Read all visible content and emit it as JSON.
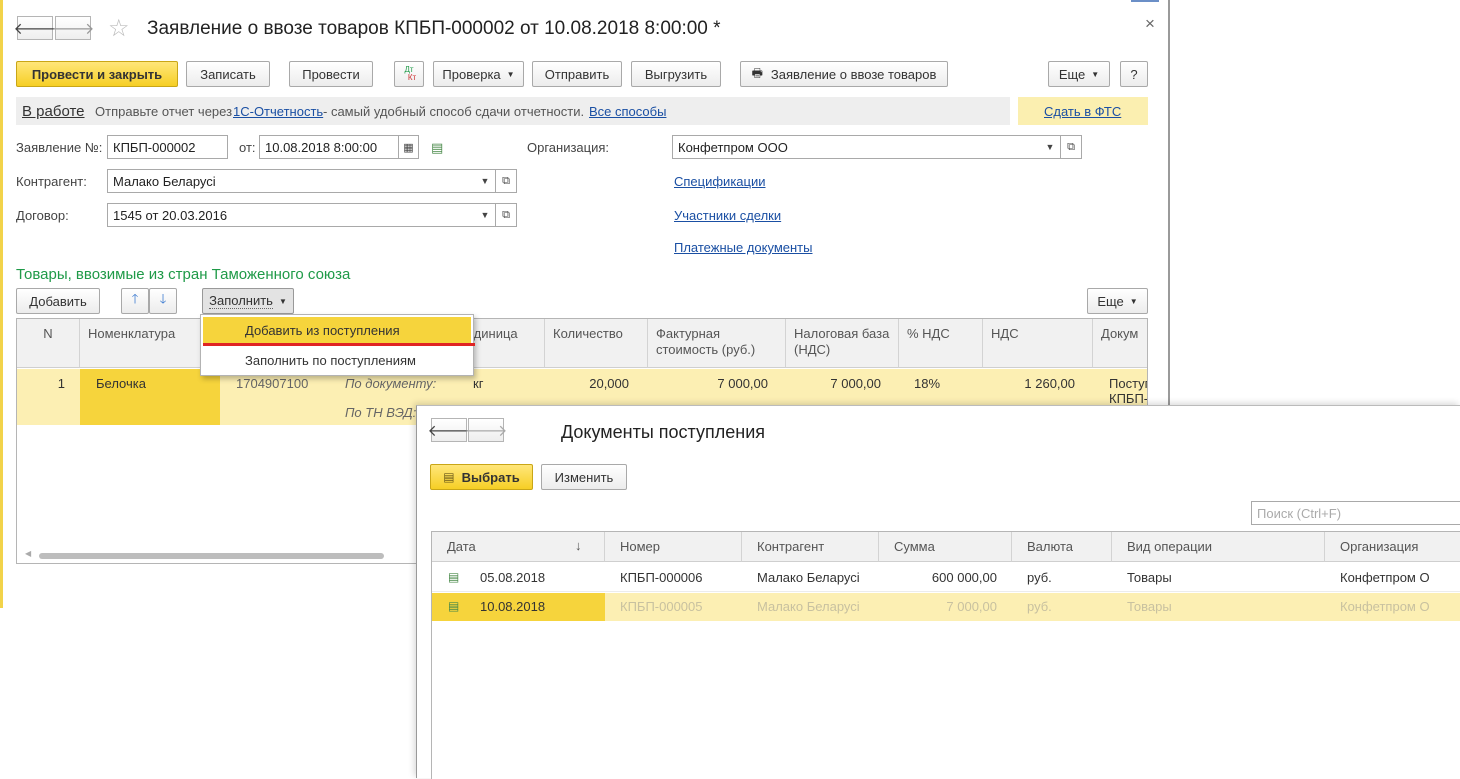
{
  "main": {
    "title": "Заявление о ввозе товаров КПБП-000002 от 10.08.2018 8:00:00 *",
    "close": "×",
    "toolbar": {
      "post_close": "Провести и закрыть",
      "save": "Записать",
      "post": "Провести",
      "dtkt_top": "Дт",
      "dtkt_bottom": "Кт",
      "check": "Проверка",
      "send": "Отправить",
      "upload": "Выгрузить",
      "print_form": "Заявление о ввозе товаров",
      "more": "Еще",
      "help": "?"
    },
    "info_bar": {
      "status_link": "В работе",
      "text_before": "Отправьте отчет через",
      "service_link": "1С-Отчетность",
      "text_after": "- самый удобный способ сдачи отчетности.",
      "all_ways_link": "Все способы",
      "submit_link": "Сдать в ФТС"
    },
    "form": {
      "number_label": "Заявление №:",
      "number_value": "КПБП-000002",
      "date_label": "от:",
      "date_value": "10.08.2018  8:00:00",
      "org_label": "Организация:",
      "org_value": "Конфетпром ООО",
      "counterparty_label": "Контрагент:",
      "counterparty_value": "Малако Беларусі",
      "contract_label": "Договор:",
      "contract_value": "1545 от 20.03.2016",
      "links": [
        "Спецификации",
        "Участники сделки",
        "Платежные документы"
      ]
    },
    "goods_section": {
      "title": "Товары, ввозимые из стран Таможенного союза",
      "add": "Добавить",
      "fill": "Заполнить",
      "more": "Еще",
      "columns": [
        "N",
        "Номенклатура",
        "",
        "",
        "Единица",
        "Количество",
        "Фактурная стоимость (руб.)",
        "Налоговая база (НДС)",
        "% НДС",
        "НДС",
        "Докум"
      ],
      "row": {
        "n": "1",
        "item": "Белочка",
        "code": "1704907100",
        "by_doc": "По документу:",
        "by_tn": "По ТН ВЭД:",
        "unit": "кг",
        "qty": "20,000",
        "invoice": "7 000,00",
        "tax_base": "7 000,00",
        "vat_rate": "18%",
        "vat": "1 260,00",
        "doc1": "Поступ",
        "doc2": "КПБП-"
      }
    },
    "fill_menu": {
      "items": [
        "Добавить из поступления",
        "Заполнить по поступлениям"
      ]
    }
  },
  "sub": {
    "title": "Документы поступления",
    "select": "Выбрать",
    "edit": "Изменить",
    "search_placeholder": "Поиск (Ctrl+F)",
    "columns": [
      "Дата",
      "Номер",
      "Контрагент",
      "Сумма",
      "Валюта",
      "Вид операции",
      "Организация"
    ],
    "sort_arrow": "↓",
    "rows": [
      {
        "date": "05.08.2018",
        "number": "КПБП-000006",
        "counterparty": "Малако Беларусі",
        "sum": "600 000,00",
        "currency": "руб.",
        "operation": "Товары",
        "org": "Конфетпром О"
      },
      {
        "date": "10.08.2018",
        "number": "КПБП-000005",
        "counterparty": "Малако Беларусі",
        "sum": "7 000,00",
        "currency": "руб.",
        "operation": "Товары",
        "org": "Конфетпром О"
      }
    ]
  },
  "colors": {
    "accent_yellow": "#f6cf25",
    "row_selected": "#fcefb3",
    "link": "#1a4fa3",
    "section_green": "#1f9a48"
  }
}
